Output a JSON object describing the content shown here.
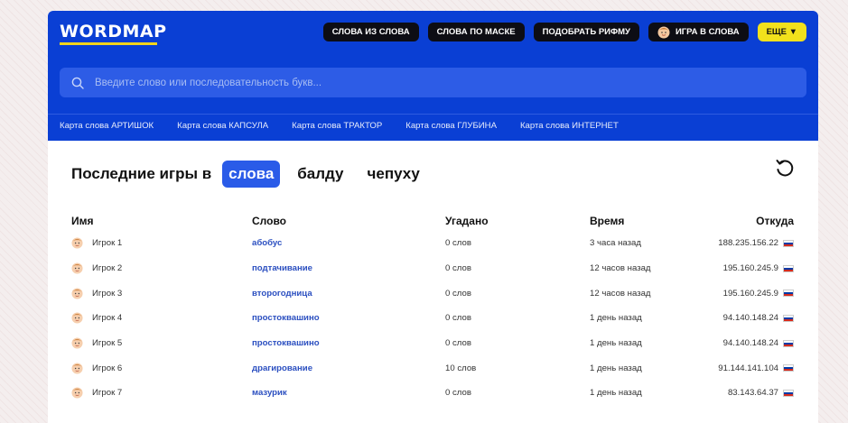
{
  "logo": "WORDMAP",
  "nav": [
    {
      "label": "СЛОВА ИЗ СЛОВА"
    },
    {
      "label": "СЛОВА ПО МАСКЕ"
    },
    {
      "label": "ПОДОБРАТЬ РИФМУ"
    },
    {
      "label": "ИГРА В СЛОВА"
    },
    {
      "label": "ЕЩЕ ▼"
    }
  ],
  "search": {
    "placeholder": "Введите слово или последовательность букв..."
  },
  "links": [
    "Карта слова АРТИШОК",
    "Карта слова КАПСУЛА",
    "Карта слова ТРАКТОР",
    "Карта слова ГЛУБИНА",
    "Карта слова ИНТЕРНЕТ"
  ],
  "games": {
    "title": "Последние игры в",
    "tabs": [
      "слова",
      "балду",
      "чепуху"
    ],
    "active_tab": "слова"
  },
  "table": {
    "headers": [
      "Имя",
      "Слово",
      "Угадано",
      "Время",
      "Откуда"
    ],
    "rows": [
      {
        "name": "Игрок 1",
        "word": "абобус",
        "guessed": "0 слов",
        "time": "3 часа назад",
        "ip": "188.235.156.22"
      },
      {
        "name": "Игрок 2",
        "word": "подтачивание",
        "guessed": "0 слов",
        "time": "12 часов назад",
        "ip": "195.160.245.9"
      },
      {
        "name": "Игрок 3",
        "word": "второгодница",
        "guessed": "0 слов",
        "time": "12 часов назад",
        "ip": "195.160.245.9"
      },
      {
        "name": "Игрок 4",
        "word": "простоквашино",
        "guessed": "0 слов",
        "time": "1 день назад",
        "ip": "94.140.148.24"
      },
      {
        "name": "Игрок 5",
        "word": "простоквашино",
        "guessed": "0 слов",
        "time": "1 день назад",
        "ip": "94.140.148.24"
      },
      {
        "name": "Игрок 6",
        "word": "драгирование",
        "guessed": "10 слов",
        "time": "1 день назад",
        "ip": "91.144.141.104"
      },
      {
        "name": "Игрок 7",
        "word": "мазурик",
        "guessed": "0 слов",
        "time": "1 день назад",
        "ip": "83.143.64.37"
      }
    ]
  },
  "colors": {
    "header_bg": "#0a3fd4",
    "active_tab": "#2a5be8",
    "link": "#2b4fc0",
    "accent_yellow": "#f2e11c"
  },
  "icons": {
    "search": "search-icon",
    "refresh": "refresh-icon",
    "avatar": "face-avatar-icon",
    "flag": "russia-flag-icon"
  }
}
